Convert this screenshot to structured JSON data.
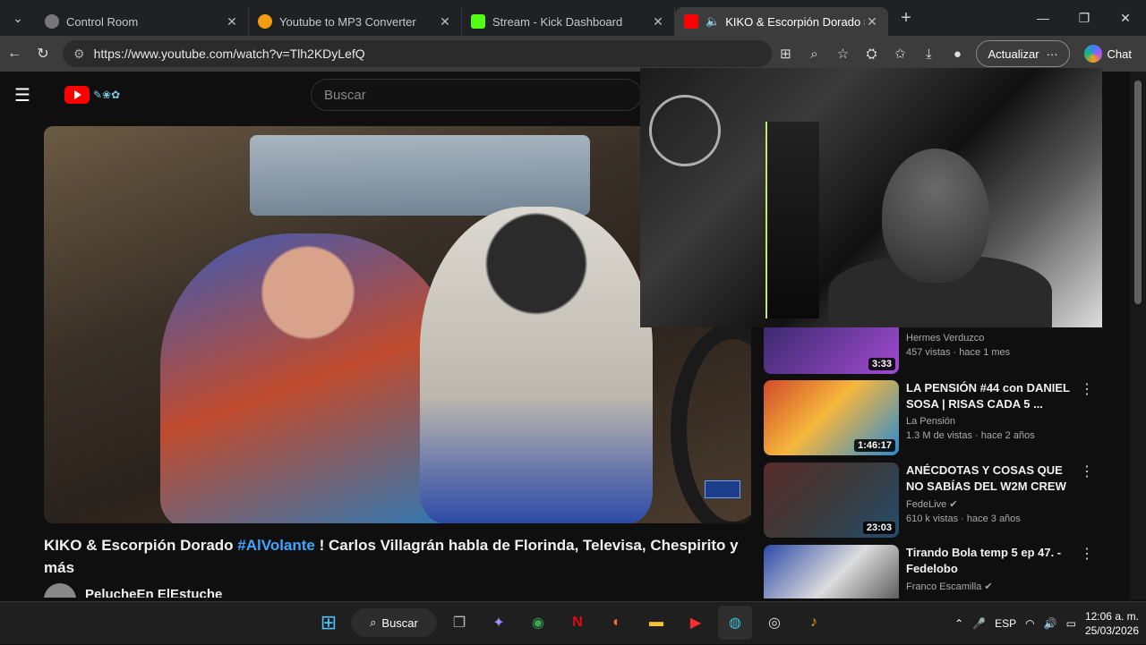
{
  "browser": {
    "tabs": [
      {
        "title": "Control Room",
        "active": false
      },
      {
        "title": "Youtube to MP3 Converter",
        "active": false
      },
      {
        "title": "Stream - Kick Dashboard",
        "active": false
      },
      {
        "title": "KIKO & Escorpión Dorado #Al",
        "active": true
      }
    ],
    "url": "https://www.youtube.com/watch?v=Tlh2KDyLefQ",
    "update_label": "Actualizar",
    "chat_label": "Chat"
  },
  "youtube": {
    "search_placeholder": "Buscar",
    "video_title_pre": "KIKO & Escorpión Dorado ",
    "video_title_tag": "#AlVolante",
    "video_title_post": " ! Carlos Villagrán habla de Florinda, Televisa, Chespirito y más",
    "channel_name": "PelucheEn ElEstuche",
    "recommendations": [
      {
        "title": "",
        "channel": "Hermes Verduzco",
        "stats": "457 vistas · hace 1 mes",
        "duration": "3:33"
      },
      {
        "title": "LA PENSIÓN #44 con DANIEL SOSA | RISAS CADA 5 ...",
        "channel": "La Pensión",
        "stats": "1.3 M de vistas · hace 2 años",
        "duration": "1:46:17"
      },
      {
        "title": "ANÉCDOTAS Y COSAS QUE NO SABÍAS DEL W2M CREW",
        "channel": "FedeLive",
        "stats": "610 k vistas · hace 3 años",
        "duration": "23:03"
      },
      {
        "title": "Tirando Bola temp 5 ep 47. - Fedelobo",
        "channel": "Franco Escamilla",
        "stats": "",
        "duration": ""
      }
    ]
  },
  "taskbar": {
    "search_label": "Buscar",
    "lang": "ESP",
    "time": "12:06 a. m.",
    "date": "25/03/2026"
  },
  "colors": {
    "accent": "#3ea6ff",
    "youtube_red": "#ff0000"
  }
}
